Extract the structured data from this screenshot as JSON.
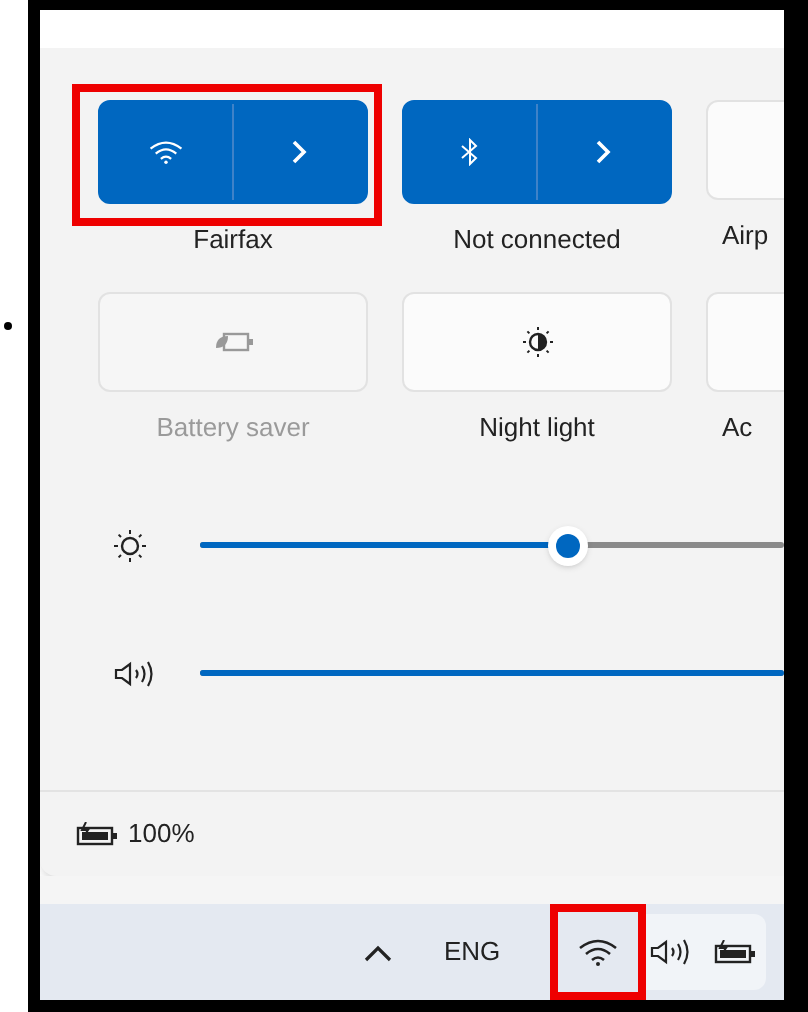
{
  "quick_settings": [
    {
      "kind": "split",
      "label": "Fairfax",
      "on": true,
      "disabled": false
    },
    {
      "kind": "split",
      "label": "Not connected",
      "on": true,
      "disabled": false
    },
    {
      "kind": "toggle",
      "label": "Airp",
      "on": false,
      "disabled": false
    },
    {
      "kind": "toggle",
      "label": "Battery saver",
      "on": false,
      "disabled": true
    },
    {
      "kind": "toggle",
      "label": "Night light",
      "on": false,
      "disabled": false
    },
    {
      "kind": "toggle",
      "label": "Ac",
      "on": false,
      "disabled": false
    }
  ],
  "sliders": [
    {
      "level": 0.63
    },
    {
      "level": 1
    }
  ],
  "battery": {
    "reading": "100%"
  },
  "taskbar": {
    "language": "ENG"
  }
}
